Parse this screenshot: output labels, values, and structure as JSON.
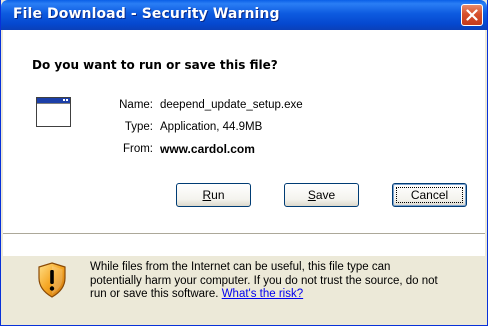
{
  "window": {
    "title": "File Download - Security Warning"
  },
  "dialog": {
    "question": "Do you want to run or save this file?",
    "file": {
      "name_label": "Name:",
      "name_value": "deepend_update_setup.exe",
      "type_label": "Type:",
      "type_value": "Application, 44.9MB",
      "from_label": "From:",
      "from_value": "www.cardol.com"
    },
    "buttons": {
      "run_mnemonic": "R",
      "run_rest": "un",
      "save_mnemonic": "S",
      "save_rest": "ave",
      "cancel_label": "Cancel"
    },
    "warning": {
      "line1": "While files from the Internet can be useful, this file type can",
      "line2": "potentially harm your computer. If you do not trust the source, do not",
      "line3": "run or save this software.",
      "link_text": "What's the risk?"
    }
  },
  "colors": {
    "titlebar": "#0a5fe7",
    "dialog_bg": "#ece9d8",
    "link": "#0000ee",
    "shield_orange": "#f0a020"
  },
  "icons": [
    "close-icon",
    "application-window-icon",
    "security-shield-icon"
  ]
}
